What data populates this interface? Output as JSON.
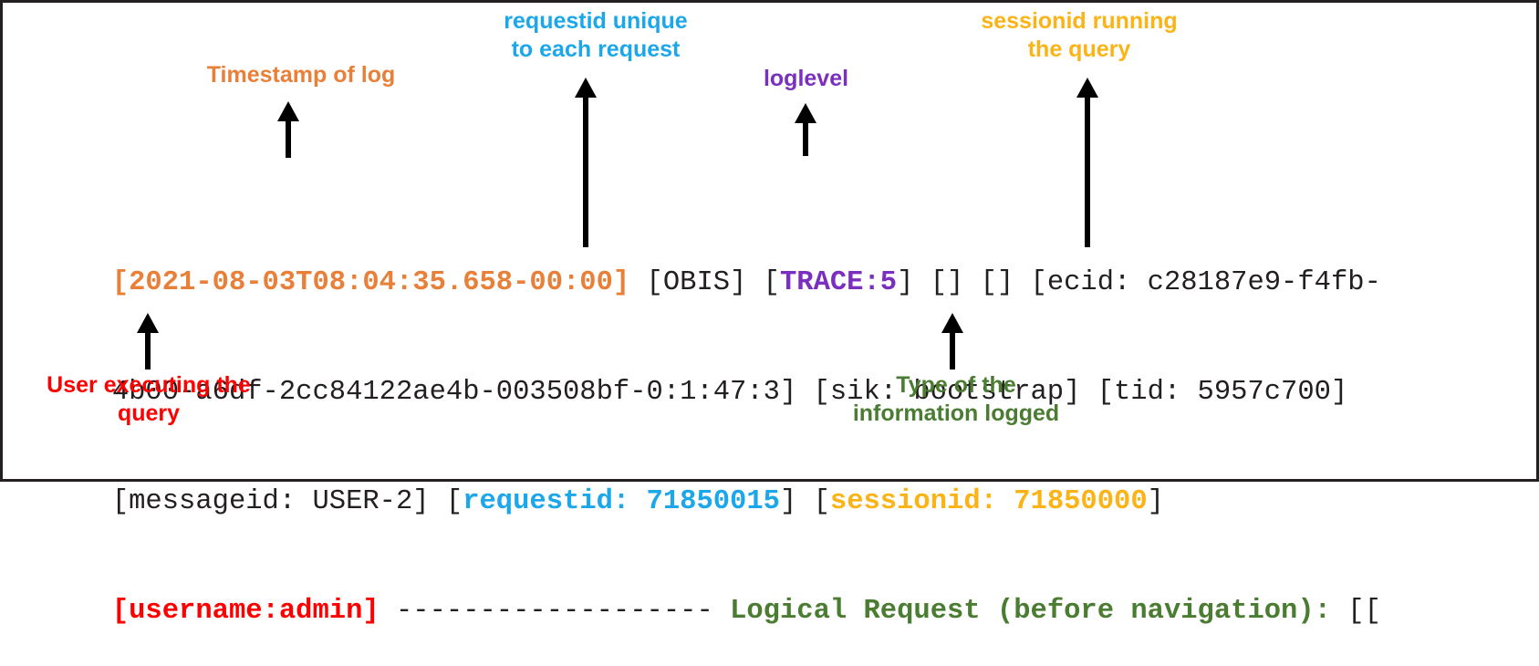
{
  "log": {
    "line1": [
      {
        "text": "[2021-08-03T08:04:35.658-00:00]",
        "style": "orange"
      },
      {
        "text": " [OBIS] [",
        "style": "plain"
      },
      {
        "text": "TRACE:5",
        "style": "purple"
      },
      {
        "text": "] [] [] [ecid: c28187e9-f4fb-",
        "style": "plain"
      }
    ],
    "line2": [
      {
        "text": "4b00-a6df-2cc84122ae4b-003508bf-0:1:47:3] [sik: bootstrap] [tid: 5957c700]",
        "style": "plain"
      }
    ],
    "line3": [
      {
        "text": "[messageid: USER-2] [",
        "style": "plain"
      },
      {
        "text": "requestid: 71850015",
        "style": "cyan"
      },
      {
        "text": "] [",
        "style": "plain"
      },
      {
        "text": "sessionid: 71850000",
        "style": "gold"
      },
      {
        "text": "]",
        "style": "plain"
      }
    ],
    "line4": [
      {
        "text": "[username:admin]",
        "style": "red"
      },
      {
        "text": " ------------------- ",
        "style": "dashes"
      },
      {
        "text": "Logical Request (before navigation):",
        "style": "green"
      },
      {
        "text": " [[",
        "style": "plain"
      }
    ]
  },
  "annotations": {
    "timestamp": {
      "label": "Timestamp of log",
      "color": "#e8803a"
    },
    "requestid": {
      "label": "requestid unique\nto each request",
      "color": "#1ca7ea"
    },
    "loglevel": {
      "label": "loglevel",
      "color": "#7b2fbe"
    },
    "sessionid": {
      "label": "sessionid running\nthe query",
      "color": "#fbb316"
    },
    "username": {
      "label": "User executing the\nquery",
      "color": "#ff0000"
    },
    "logtype": {
      "label": "Type of the\ninformation logged",
      "color": "#4a7c32"
    }
  },
  "icons": {
    "arrow_up": "arrow-up-icon"
  }
}
